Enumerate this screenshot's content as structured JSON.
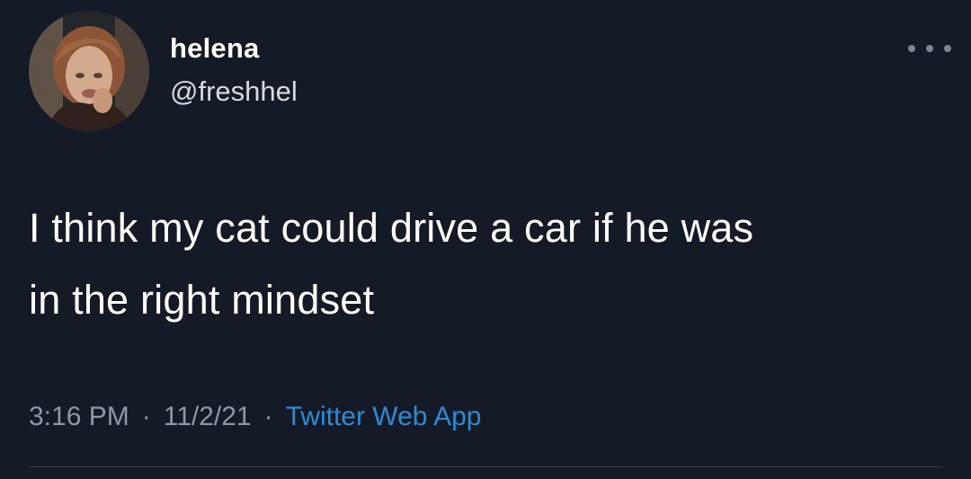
{
  "tweet": {
    "author": {
      "display_name": "helena",
      "handle": "@freshhel"
    },
    "text": "I think my cat could drive a car if he was\nin the right mindset",
    "time": "3:16 PM",
    "date": "11/2/21",
    "separator": "·",
    "source": "Twitter Web App"
  },
  "icons": {
    "more": "more-horizontal-icon",
    "avatar": "profile-photo"
  },
  "colors": {
    "background": "#151b26",
    "text": "#ffffff",
    "muted": "#8e98a4",
    "link": "#2b8bd9"
  }
}
